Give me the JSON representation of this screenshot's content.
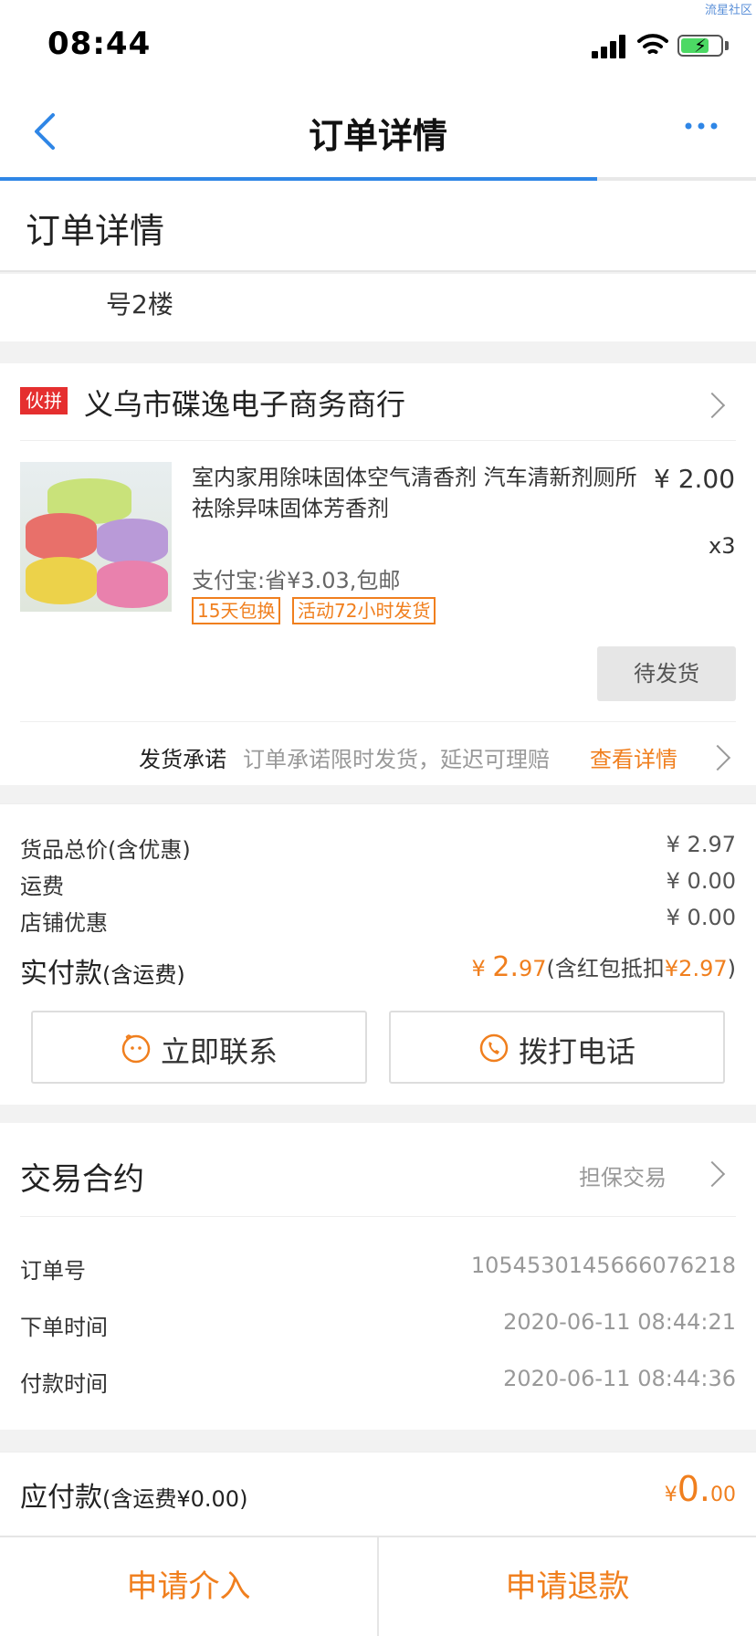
{
  "status_bar": {
    "time": "08:44",
    "watermark": "流星社区"
  },
  "nav": {
    "title": "订单详情",
    "progress": 0.79
  },
  "header": {
    "title": "订单详情"
  },
  "address": {
    "text": "号2楼"
  },
  "store": {
    "badge": "伙拼",
    "name": "义乌市碟逸电子商务商行",
    "product": {
      "title": "室内家用除味固体空气清香剂 汽车清新剂厕所祛除异味固体芳香剂",
      "price": "¥ 2.00",
      "qty": "x3",
      "subtitle": "支付宝:省¥3.03,包邮",
      "tags": [
        "15天包换",
        "活动72小时发货"
      ]
    },
    "status_button": "待发货",
    "promise": {
      "label": "发货承诺",
      "desc": "订单承诺限时发货，延迟可理赔",
      "link": "查看详情"
    }
  },
  "price": {
    "rows": [
      {
        "label": "货品总价(含优惠)",
        "value": "¥ 2.97"
      },
      {
        "label": "运费",
        "value": "¥ 0.00"
      },
      {
        "label": "店铺优惠",
        "value": "¥ 0.00"
      }
    ],
    "paid_label": "实付款",
    "paid_label_suffix": "(含运费)",
    "paid_symbol": "¥ ",
    "paid_int": "2.",
    "paid_dec": "97",
    "paid_note_prefix": "(含红包抵扣",
    "paid_note_amount": "¥2.97",
    "paid_note_suffix": ")",
    "contact_button": "立即联系",
    "call_button": "拨打电话"
  },
  "trade": {
    "title": "交易合约",
    "type": "担保交易",
    "rows": [
      {
        "label": "订单号",
        "value": "1054530145666076218"
      },
      {
        "label": "下单时间",
        "value": "2020-06-11 08:44:21"
      },
      {
        "label": "付款时间",
        "value": "2020-06-11 08:44:36"
      }
    ]
  },
  "payable": {
    "label": "应付款",
    "label_suffix": "(含运费¥0.00)",
    "symbol": "¥",
    "int": "0.",
    "dec": "00"
  },
  "bottom": {
    "left_button": "申请介入",
    "right_button": "申请退款"
  },
  "colors": {
    "accent": "#f07f1e",
    "blue": "#2f86e6",
    "badge_red": "#e52f2f"
  }
}
